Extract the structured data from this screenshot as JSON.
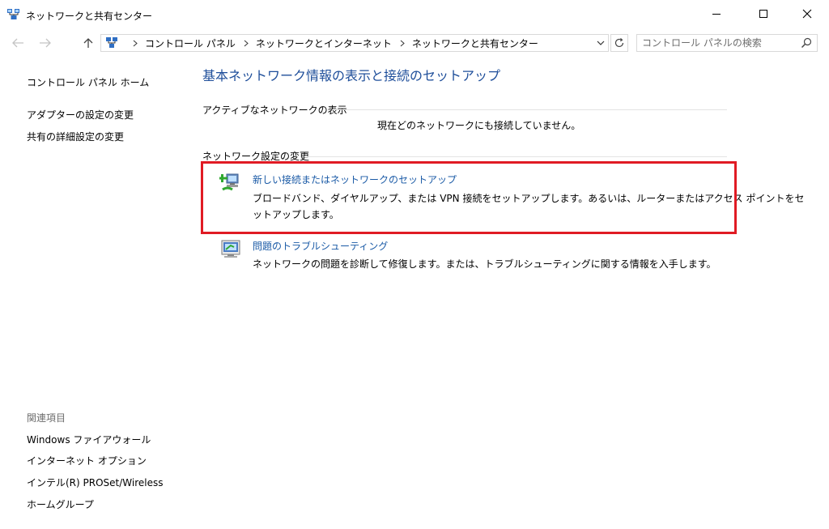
{
  "window": {
    "title": "ネットワークと共有センター",
    "icon": "network-center-icon"
  },
  "titlebar_buttons": [
    "minimize-icon",
    "maximize-icon",
    "close-icon"
  ],
  "navigation": {
    "breadcrumb": [
      "コントロール パネル",
      "ネットワークとインターネット",
      "ネットワークと共有センター"
    ],
    "search_placeholder": "コントロール パネルの検索"
  },
  "left_pane": {
    "links": [
      "コントロール パネル ホーム",
      "アダプターの設定の変更",
      "共有の詳細設定の変更"
    ],
    "related_heading": "関連項目",
    "related_links": [
      "Windows ファイアウォール",
      "インターネット オプション",
      "インテル(R) PROSet/Wireless",
      "ホームグループ"
    ]
  },
  "main": {
    "title": "基本ネットワーク情報の表示と接続のセットアップ",
    "active_networks": {
      "heading": "アクティブなネットワークの表示",
      "message": "現在どのネットワークにも接続していません。"
    },
    "change_settings": {
      "heading": "ネットワーク設定の変更",
      "tasks": [
        {
          "link": "新しい接続またはネットワークのセットアップ",
          "desc_line1": "ブロードバンド、ダイヤルアップ、または VPN 接続をセットアップします。あるいは、ルーターまたはアクセス ポイントをセ",
          "desc_line2": "ットアップします。",
          "icon": "new-connection-icon"
        },
        {
          "link": "問題のトラブルシューティング",
          "desc_line1": "ネットワークの問題を診断して修復します。または、トラブルシューティングに関する情報を入手します。",
          "icon": "troubleshoot-icon"
        }
      ]
    }
  },
  "colors": {
    "title_blue": "#1e4e9a",
    "link_blue": "#1a5aa6",
    "highlight_red": "#e01b24"
  }
}
